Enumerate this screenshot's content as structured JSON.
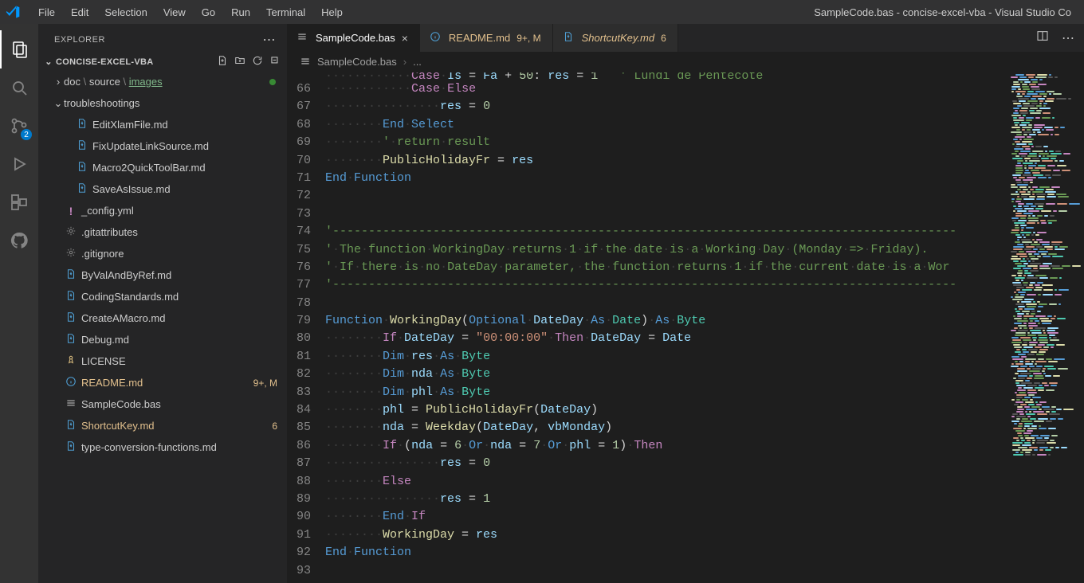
{
  "menubar": {
    "items": [
      "File",
      "Edit",
      "Selection",
      "View",
      "Go",
      "Run",
      "Terminal",
      "Help"
    ],
    "title": "SampleCode.bas - concise-excel-vba - Visual Studio Co"
  },
  "activityBar": {
    "sourceControlBadge": "2"
  },
  "sidebar": {
    "title": "EXPLORER",
    "section": "CONCISE-EXCEL-VBA",
    "entries": [
      {
        "kind": "folder-path",
        "depth": 1,
        "segments": [
          "doc",
          "source",
          "images"
        ],
        "dot": true,
        "chev": ">"
      },
      {
        "kind": "folder",
        "depth": 1,
        "label": "troubleshootings",
        "chev": "v"
      },
      {
        "kind": "file",
        "depth": 2,
        "label": "EditXlamFile.md",
        "icon": "md-blue"
      },
      {
        "kind": "file",
        "depth": 2,
        "label": "FixUpdateLinkSource.md",
        "icon": "md-blue"
      },
      {
        "kind": "file",
        "depth": 2,
        "label": "Macro2QuickToolBar.md",
        "icon": "md-blue"
      },
      {
        "kind": "file",
        "depth": 2,
        "label": "SaveAsIssue.md",
        "icon": "md-blue"
      },
      {
        "kind": "file",
        "depth": 1,
        "label": "_config.yml",
        "icon": "yml",
        "cc": "purple"
      },
      {
        "kind": "file",
        "depth": 1,
        "label": ".gitattributes",
        "icon": "gear",
        "cc": "grey"
      },
      {
        "kind": "file",
        "depth": 1,
        "label": ".gitignore",
        "icon": "gear",
        "cc": "grey"
      },
      {
        "kind": "file",
        "depth": 1,
        "label": "ByValAndByRef.md",
        "icon": "md-blue"
      },
      {
        "kind": "file",
        "depth": 1,
        "label": "CodingStandards.md",
        "icon": "md-blue"
      },
      {
        "kind": "file",
        "depth": 1,
        "label": "CreateAMacro.md",
        "icon": "md-blue"
      },
      {
        "kind": "file",
        "depth": 1,
        "label": "Debug.md",
        "icon": "md-blue"
      },
      {
        "kind": "file",
        "depth": 1,
        "label": "LICENSE",
        "icon": "lic",
        "cc": "yellow"
      },
      {
        "kind": "file",
        "depth": 1,
        "label": "README.md",
        "icon": "info",
        "labelColor": "c-yellow",
        "trail": "9+, M",
        "trailColor": "c-yellow"
      },
      {
        "kind": "file",
        "depth": 1,
        "label": "SampleCode.bas",
        "icon": "ham",
        "cc": "grey"
      },
      {
        "kind": "file",
        "depth": 1,
        "label": "ShortcutKey.md",
        "icon": "md-blue",
        "labelColor": "c-yellow",
        "trail": "6",
        "trailColor": "c-yellow"
      },
      {
        "kind": "file",
        "depth": 1,
        "label": "type-conversion-functions.md",
        "icon": "md-blue"
      }
    ]
  },
  "tabs": [
    {
      "icon": "ham",
      "label": "SampleCode.bas",
      "active": true,
      "close": true
    },
    {
      "icon": "info",
      "label": "README.md",
      "trail": "9+, M",
      "labelColor": "c-yellow",
      "trailColor": "c-yellow"
    },
    {
      "icon": "md-blue",
      "label": "ShortcutKey.md",
      "italic": true,
      "trail": "6",
      "labelColor": "c-yellow",
      "trailColor": "c-yellow"
    }
  ],
  "breadcrumb": {
    "file": "SampleCode.bas",
    "more": "..."
  },
  "code": {
    "startLine": 66,
    "lines": [
      [
        [
          "ws",
          "············"
        ],
        [
          "pk",
          "Case"
        ],
        [
          "ws",
          "·"
        ],
        [
          "pk",
          "Else"
        ]
      ],
      [
        [
          "ws",
          "················"
        ],
        [
          "id",
          "res"
        ],
        [
          "op",
          " = "
        ],
        [
          "nu",
          "0"
        ]
      ],
      [
        [
          "ws",
          "········"
        ],
        [
          "kw",
          "End"
        ],
        [
          "ws",
          "·"
        ],
        [
          "kw",
          "Select"
        ]
      ],
      [
        [
          "ws",
          "········"
        ],
        [
          "cm",
          "'"
        ],
        [
          "ws",
          "·"
        ],
        [
          "cm",
          "return"
        ],
        [
          "ws",
          "·"
        ],
        [
          "cm",
          "result"
        ]
      ],
      [
        [
          "ws",
          "········"
        ],
        [
          "fn",
          "PublicHolidayFr"
        ],
        [
          "op",
          " = "
        ],
        [
          "id",
          "res"
        ]
      ],
      [
        [
          "kw",
          "End"
        ],
        [
          "ws",
          "·"
        ],
        [
          "kw",
          "Function"
        ]
      ],
      [],
      [],
      [
        [
          "cm",
          "'---------------------------------------------------------------------------------------"
        ]
      ],
      [
        [
          "cm",
          "'"
        ],
        [
          "ws",
          "·"
        ],
        [
          "cm",
          "The"
        ],
        [
          "ws",
          "·"
        ],
        [
          "cm",
          "function"
        ],
        [
          "ws",
          "·"
        ],
        [
          "cm",
          "WorkingDay"
        ],
        [
          "ws",
          "·"
        ],
        [
          "cm",
          "returns"
        ],
        [
          "ws",
          "·"
        ],
        [
          "cm",
          "1"
        ],
        [
          "ws",
          "·"
        ],
        [
          "cm",
          "if"
        ],
        [
          "ws",
          "·"
        ],
        [
          "cm",
          "the"
        ],
        [
          "ws",
          "·"
        ],
        [
          "cm",
          "date"
        ],
        [
          "ws",
          "·"
        ],
        [
          "cm",
          "is"
        ],
        [
          "ws",
          "·"
        ],
        [
          "cm",
          "a"
        ],
        [
          "ws",
          "·"
        ],
        [
          "cm",
          "Working"
        ],
        [
          "ws",
          "·"
        ],
        [
          "cm",
          "Day"
        ],
        [
          "ws",
          "·"
        ],
        [
          "cm",
          "(Monday"
        ],
        [
          "ws",
          "·"
        ],
        [
          "cm",
          "=>"
        ],
        [
          "ws",
          "·"
        ],
        [
          "cm",
          "Friday)."
        ]
      ],
      [
        [
          "cm",
          "'"
        ],
        [
          "ws",
          "·"
        ],
        [
          "cm",
          "If"
        ],
        [
          "ws",
          "·"
        ],
        [
          "cm",
          "there"
        ],
        [
          "ws",
          "·"
        ],
        [
          "cm",
          "is"
        ],
        [
          "ws",
          "·"
        ],
        [
          "cm",
          "no"
        ],
        [
          "ws",
          "·"
        ],
        [
          "cm",
          "DateDay"
        ],
        [
          "ws",
          "·"
        ],
        [
          "cm",
          "parameter,"
        ],
        [
          "ws",
          "·"
        ],
        [
          "cm",
          "the"
        ],
        [
          "ws",
          "·"
        ],
        [
          "cm",
          "function"
        ],
        [
          "ws",
          "·"
        ],
        [
          "cm",
          "returns"
        ],
        [
          "ws",
          "·"
        ],
        [
          "cm",
          "1"
        ],
        [
          "ws",
          "·"
        ],
        [
          "cm",
          "if"
        ],
        [
          "ws",
          "·"
        ],
        [
          "cm",
          "the"
        ],
        [
          "ws",
          "·"
        ],
        [
          "cm",
          "current"
        ],
        [
          "ws",
          "·"
        ],
        [
          "cm",
          "date"
        ],
        [
          "ws",
          "·"
        ],
        [
          "cm",
          "is"
        ],
        [
          "ws",
          "·"
        ],
        [
          "cm",
          "a"
        ],
        [
          "ws",
          "·"
        ],
        [
          "cm",
          "Wor"
        ]
      ],
      [
        [
          "cm",
          "'---------------------------------------------------------------------------------------"
        ]
      ],
      [],
      [
        [
          "kw",
          "Function"
        ],
        [
          "ws",
          "·"
        ],
        [
          "fn",
          "WorkingDay"
        ],
        [
          "op",
          "("
        ],
        [
          "kw",
          "Optional"
        ],
        [
          "ws",
          "·"
        ],
        [
          "id",
          "DateDay"
        ],
        [
          "ws",
          "·"
        ],
        [
          "kw",
          "As"
        ],
        [
          "ws",
          "·"
        ],
        [
          "ty",
          "Date"
        ],
        [
          "op",
          ")"
        ],
        [
          "ws",
          "·"
        ],
        [
          "kw",
          "As"
        ],
        [
          "ws",
          "·"
        ],
        [
          "ty",
          "Byte"
        ]
      ],
      [
        [
          "ws",
          "········"
        ],
        [
          "pk",
          "If"
        ],
        [
          "ws",
          "·"
        ],
        [
          "id",
          "DateDay"
        ],
        [
          "op",
          " = "
        ],
        [
          "st",
          "\"00:00:00\""
        ],
        [
          "ws",
          "·"
        ],
        [
          "pk",
          "Then"
        ],
        [
          "ws",
          "·"
        ],
        [
          "id",
          "DateDay"
        ],
        [
          "op",
          " = "
        ],
        [
          "id",
          "Date"
        ]
      ],
      [
        [
          "ws",
          "········"
        ],
        [
          "kw",
          "Dim"
        ],
        [
          "ws",
          "·"
        ],
        [
          "id",
          "res"
        ],
        [
          "ws",
          "·"
        ],
        [
          "kw",
          "As"
        ],
        [
          "ws",
          "·"
        ],
        [
          "ty",
          "Byte"
        ]
      ],
      [
        [
          "ws",
          "········"
        ],
        [
          "kw",
          "Dim"
        ],
        [
          "ws",
          "·"
        ],
        [
          "id",
          "nda"
        ],
        [
          "ws",
          "·"
        ],
        [
          "kw",
          "As"
        ],
        [
          "ws",
          "·"
        ],
        [
          "ty",
          "Byte"
        ]
      ],
      [
        [
          "ws",
          "········"
        ],
        [
          "kw",
          "Dim"
        ],
        [
          "ws",
          "·"
        ],
        [
          "id",
          "phl"
        ],
        [
          "ws",
          "·"
        ],
        [
          "kw",
          "As"
        ],
        [
          "ws",
          "·"
        ],
        [
          "ty",
          "Byte"
        ]
      ],
      [
        [
          "ws",
          "········"
        ],
        [
          "id",
          "phl"
        ],
        [
          "op",
          " = "
        ],
        [
          "fn",
          "PublicHolidayFr"
        ],
        [
          "op",
          "("
        ],
        [
          "id",
          "DateDay"
        ],
        [
          "op",
          ")"
        ]
      ],
      [
        [
          "ws",
          "········"
        ],
        [
          "id",
          "nda"
        ],
        [
          "op",
          " = "
        ],
        [
          "fn",
          "Weekday"
        ],
        [
          "op",
          "("
        ],
        [
          "id",
          "DateDay"
        ],
        [
          "op",
          ", "
        ],
        [
          "id",
          "vbMonday"
        ],
        [
          "op",
          ")"
        ]
      ],
      [
        [
          "ws",
          "········"
        ],
        [
          "pk",
          "If"
        ],
        [
          "ws",
          "·"
        ],
        [
          "op",
          "("
        ],
        [
          "id",
          "nda"
        ],
        [
          "op",
          " = "
        ],
        [
          "nu",
          "6"
        ],
        [
          "ws",
          "·"
        ],
        [
          "kw",
          "Or"
        ],
        [
          "ws",
          "·"
        ],
        [
          "id",
          "nda"
        ],
        [
          "op",
          " = "
        ],
        [
          "nu",
          "7"
        ],
        [
          "ws",
          "·"
        ],
        [
          "kw",
          "Or"
        ],
        [
          "ws",
          "·"
        ],
        [
          "id",
          "phl"
        ],
        [
          "op",
          " = "
        ],
        [
          "nu",
          "1"
        ],
        [
          "op",
          ")"
        ],
        [
          "ws",
          "·"
        ],
        [
          "pk",
          "Then"
        ]
      ],
      [
        [
          "ws",
          "················"
        ],
        [
          "id",
          "res"
        ],
        [
          "op",
          " = "
        ],
        [
          "nu",
          "0"
        ]
      ],
      [
        [
          "ws",
          "········"
        ],
        [
          "pk",
          "Else"
        ]
      ],
      [
        [
          "ws",
          "················"
        ],
        [
          "id",
          "res"
        ],
        [
          "op",
          " = "
        ],
        [
          "nu",
          "1"
        ]
      ],
      [
        [
          "ws",
          "········"
        ],
        [
          "kw",
          "End"
        ],
        [
          "ws",
          "·"
        ],
        [
          "pk",
          "If"
        ]
      ],
      [
        [
          "ws",
          "········"
        ],
        [
          "fn",
          "WorkingDay"
        ],
        [
          "op",
          " = "
        ],
        [
          "id",
          "res"
        ]
      ],
      [
        [
          "kw",
          "End"
        ],
        [
          "ws",
          "·"
        ],
        [
          "kw",
          "Function"
        ]
      ],
      []
    ]
  }
}
